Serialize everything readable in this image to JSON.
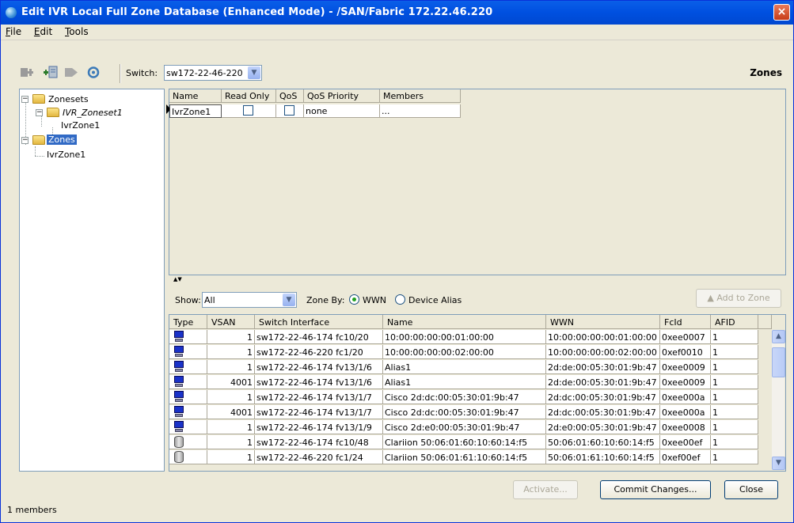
{
  "window": {
    "title": "Edit IVR Local Full Zone Database (Enhanced Mode) - /SAN/Fabric 172.22.46.220",
    "close_label": "×"
  },
  "menu": [
    {
      "label": "File",
      "mnemonic": "F",
      "rest": "ile"
    },
    {
      "label": "Edit",
      "mnemonic": "E",
      "rest": "dit"
    },
    {
      "label": "Tools",
      "mnemonic": "T",
      "rest": "ools"
    }
  ],
  "toolbar": {
    "switch_label": "Switch:",
    "switch_value": "sw172-22-46-220",
    "section_label": "Zones"
  },
  "tree": {
    "zonesets_label": "Zonesets",
    "zoneset_label": "IVR_Zoneset1",
    "zoneset_child": "IvrZone1",
    "zones_label": "Zones",
    "zones_child": "IvrZone1"
  },
  "zones_table": {
    "headers": [
      "Name",
      "Read Only",
      "QoS",
      "QoS Priority",
      "Members"
    ],
    "rows": [
      {
        "name": "IvrZone1",
        "read_only": false,
        "qos": false,
        "qos_priority": "none",
        "members": "..."
      }
    ]
  },
  "filter": {
    "show_label": "Show:",
    "show_value": "All",
    "zone_by_label": "Zone By:",
    "option_wwn": "WWN",
    "option_alias": "Device Alias",
    "selected": "WWN",
    "add_button": "Add to Zone"
  },
  "members_table": {
    "headers": [
      "Type",
      "VSAN",
      "Switch Interface",
      "Name",
      "WWN",
      "FcId",
      "AFID"
    ],
    "rows": [
      {
        "type": "host",
        "vsan": "1",
        "iface": "sw172-22-46-174 fc10/20",
        "name": "10:00:00:00:00:01:00:00",
        "wwn": "10:00:00:00:00:01:00:00",
        "fcid": "0xee0007",
        "afid": "1"
      },
      {
        "type": "host",
        "vsan": "1",
        "iface": "sw172-22-46-220 fc1/20",
        "name": "10:00:00:00:00:02:00:00",
        "wwn": "10:00:00:00:00:02:00:00",
        "fcid": "0xef0010",
        "afid": "1"
      },
      {
        "type": "host",
        "vsan": "1",
        "iface": "sw172-22-46-174 fv13/1/6",
        "name": "Alias1",
        "wwn": "2d:de:00:05:30:01:9b:47",
        "fcid": "0xee0009",
        "afid": "1"
      },
      {
        "type": "host",
        "vsan": "4001",
        "iface": "sw172-22-46-174 fv13/1/6",
        "name": "Alias1",
        "wwn": "2d:de:00:05:30:01:9b:47",
        "fcid": "0xee0009",
        "afid": "1"
      },
      {
        "type": "host",
        "vsan": "1",
        "iface": "sw172-22-46-174 fv13/1/7",
        "name": "Cisco 2d:dc:00:05:30:01:9b:47",
        "wwn": "2d:dc:00:05:30:01:9b:47",
        "fcid": "0xee000a",
        "afid": "1"
      },
      {
        "type": "host",
        "vsan": "4001",
        "iface": "sw172-22-46-174 fv13/1/7",
        "name": "Cisco 2d:dc:00:05:30:01:9b:47",
        "wwn": "2d:dc:00:05:30:01:9b:47",
        "fcid": "0xee000a",
        "afid": "1"
      },
      {
        "type": "host",
        "vsan": "1",
        "iface": "sw172-22-46-174 fv13/1/9",
        "name": "Cisco 2d:e0:00:05:30:01:9b:47",
        "wwn": "2d:e0:00:05:30:01:9b:47",
        "fcid": "0xee0008",
        "afid": "1"
      },
      {
        "type": "disk",
        "vsan": "1",
        "iface": "sw172-22-46-174 fc10/48",
        "name": "Clariion 50:06:01:60:10:60:14:f5",
        "wwn": "50:06:01:60:10:60:14:f5",
        "fcid": "0xee00ef",
        "afid": "1"
      },
      {
        "type": "disk",
        "vsan": "1",
        "iface": "sw172-22-46-220 fc1/24",
        "name": "Clariion 50:06:01:61:10:60:14:f5",
        "wwn": "50:06:01:61:10:60:14:f5",
        "fcid": "0xef00ef",
        "afid": "1"
      }
    ]
  },
  "buttons": {
    "activate": "Activate...",
    "commit": "Commit Changes...",
    "close": "Close"
  },
  "status": {
    "text": "1 members"
  },
  "colors": {
    "title_bar": "#0050e0",
    "selection": "#316ac5",
    "window_bg": "#ece9d8"
  }
}
